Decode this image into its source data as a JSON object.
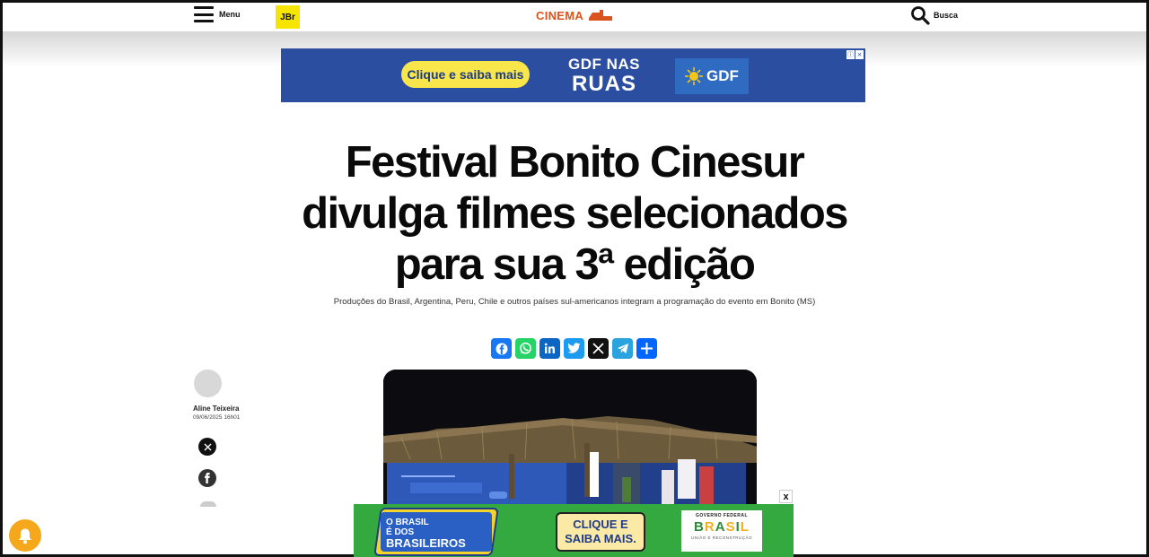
{
  "header": {
    "menu_label": "Menu",
    "logo_text": "JBr",
    "section_label": "CINEMA",
    "search_label": "Busca"
  },
  "ad_top": {
    "cta": "Clique e saiba mais",
    "campaign_line1": "GDF NAS",
    "campaign_line2": "RUAS",
    "brand": "GDF"
  },
  "article": {
    "title": "Festival Bonito Cinesur divulga filmes selecionados para sua 3ª edição",
    "subtitle": "Produções do Brasil, Argentina, Peru, Chile e outros países sul-americanos integram a programação do evento em Bonito (MS)",
    "author": "Aline Teixeira",
    "date": "09/06/2025 16h01"
  },
  "share": {
    "services": [
      "facebook-icon",
      "whatsapp-icon",
      "linkedin-icon",
      "twitter-icon",
      "x-icon",
      "telegram-icon",
      "share-icon"
    ],
    "colors": {
      "facebook": "#1877f2",
      "whatsapp": "#25d366",
      "linkedin": "#0a66c2",
      "twitter": "#1d9bf0",
      "x": "#111111",
      "telegram": "#2aa3df",
      "share": "#0166ff"
    }
  },
  "ad_bottom": {
    "badge_small": "O BRASIL",
    "badge_small2": "É DOS",
    "badge_big": "BRASILEIROS",
    "cta": "CLIQUE E SAIBA MAIS.",
    "gov_line1": "GOVERNO FEDERAL",
    "gov_line2": "BRASIL",
    "gov_line3": "UNIÃO E RECONSTRUÇÃO",
    "close": "x"
  },
  "colors": {
    "accent": "#d9541f",
    "logo_bg": "#f5e500",
    "ad_blue": "#2c4ea0",
    "ad_green": "#33a93f",
    "bell": "#f5a81c"
  }
}
